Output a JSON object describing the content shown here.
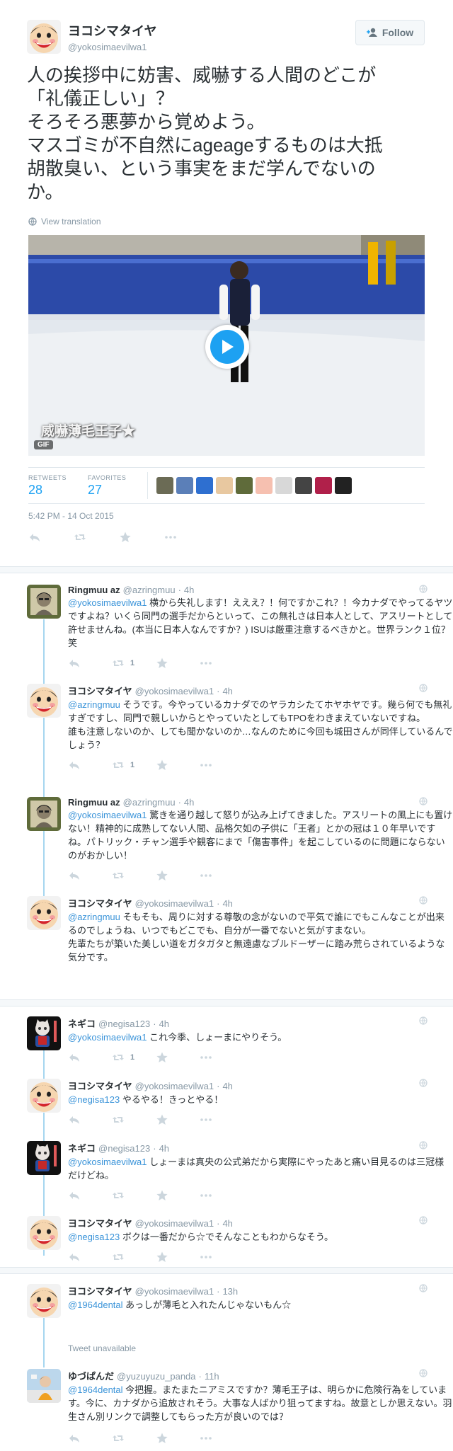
{
  "main": {
    "name": "ヨコシマタイヤ",
    "handle": "@yokosimaevilwa1",
    "follow_label": "Follow",
    "text_lines": [
      "人の挨拶中に妨害、威嚇する人間のどこが",
      "「礼儀正しい」？",
      "そろそろ悪夢から覚めよう。",
      "マスゴミが不自然にageageするものは大抵",
      "胡散臭い、という事実をまだ学んでないの",
      "か。"
    ],
    "view_translation": "View translation",
    "media_caption": "威嚇薄毛王子★",
    "gif_label": "GIF",
    "retweets_label": "RETWEETS",
    "retweets": "28",
    "favorites_label": "FAVORITES",
    "favorites": "27",
    "timestamp": "5:42 PM - 14 Oct 2015",
    "colors": {
      "accent": "#1da1f2",
      "link": "#3b94d9",
      "muted": "#8899a6"
    }
  },
  "replies": [
    {
      "name": "Ringmuu az",
      "handle": "@azringmuu",
      "time": "4h",
      "mention": "@yokosimaevilwa1",
      "text": " 横から失礼します！えええ？！何ですかこれ？！今カナダでやってるヤツですよね？いくら同門の選手だからといって、この無礼さは日本人として、アスリートとして許せませんね。(本当に日本人なんですか？) ISUは厳重注意するべきかと。世界ランク１位？笑",
      "retweets": "1"
    },
    {
      "name": "ヨコシマタイヤ",
      "handle": "@yokosimaevilwa1",
      "time": "4h",
      "mention": "@azringmuu",
      "text": " そうです。今やっているカナダでのヤラカシたてホヤホヤです。幾ら何でも無礼すぎですし、同門で親しいからとやっていたとしてもTPOをわきまえていないですね。\n誰も注意しないのか、しても聞かないのか…なんのために今回も城田さんが同伴しているんでしょう？",
      "retweets": "1"
    },
    {
      "name": "Ringmuu az",
      "handle": "@azringmuu",
      "time": "4h",
      "mention": "@yokosimaevilwa1",
      "text": " 驚きを通り越して怒りが込み上げてきました。アスリートの風上にも置けない！精神的に成熟してない人間、品格欠如の子供に「王者」とかの冠は１０年早いですね。パトリック・チャン選手や観客にまで「傷害事件」を起こしているのに問題にならないのがおかしい！",
      "retweets": ""
    },
    {
      "name": "ヨコシマタイヤ",
      "handle": "@yokosimaevilwa1",
      "time": "4h",
      "mention": "@azringmuu",
      "text": " そもそも、周りに対する尊敬の念がないので平気で誰にでもこんなことが出来るのでしょうね、いつでもどこでも、自分が一番でないと気がすまない。\n先輩たちが築いた美しい道をガタガタと無遠慮なブルドーザーに踏み荒らされているような気分です。",
      "retweets": ""
    },
    {
      "name": "ネギコ",
      "handle": "@negisa123",
      "time": "4h",
      "mention": "@yokosimaevilwa1",
      "text": " これ今季、しょーまにやりそう。",
      "retweets": "1"
    },
    {
      "name": "ヨコシマタイヤ",
      "handle": "@yokosimaevilwa1",
      "time": "4h",
      "mention": "@negisa123",
      "text": " やるやる！きっとやる！",
      "retweets": ""
    },
    {
      "name": "ネギコ",
      "handle": "@negisa123",
      "time": "4h",
      "mention": "@yokosimaevilwa1",
      "text": " しょーまは真央の公式弟だから実際にやったあと痛い目見るのは三冠様だけどね。",
      "retweets": ""
    },
    {
      "name": "ヨコシマタイヤ",
      "handle": "@yokosimaevilwa1",
      "time": "4h",
      "mention": "@negisa123",
      "text": " ボクは一番だから☆でそんなこともわからなそう。",
      "retweets": ""
    },
    {
      "name": "ヨコシマタイヤ",
      "handle": "@yokosimaevilwa1",
      "time": "13h",
      "mention": "@1964dental",
      "text": " あっしが薄毛と入れたんじゃないもん☆",
      "retweets": ""
    },
    {
      "name": "ゆづぱんだ",
      "handle": "@yuzuyuzu_panda",
      "time": "11h",
      "mention": "@1964dental",
      "text": " 今把握。またまたニアミスですか？薄毛王子は、明らかに危険行為をしています。今に、カナダから追放されそう。大事な人ばかり狙ってますね。故意としか思えない。羽生さん別リンクで調整してもらった方が良いのでは？",
      "retweets": ""
    }
  ],
  "tweet_unavailable": "Tweet unavailable"
}
